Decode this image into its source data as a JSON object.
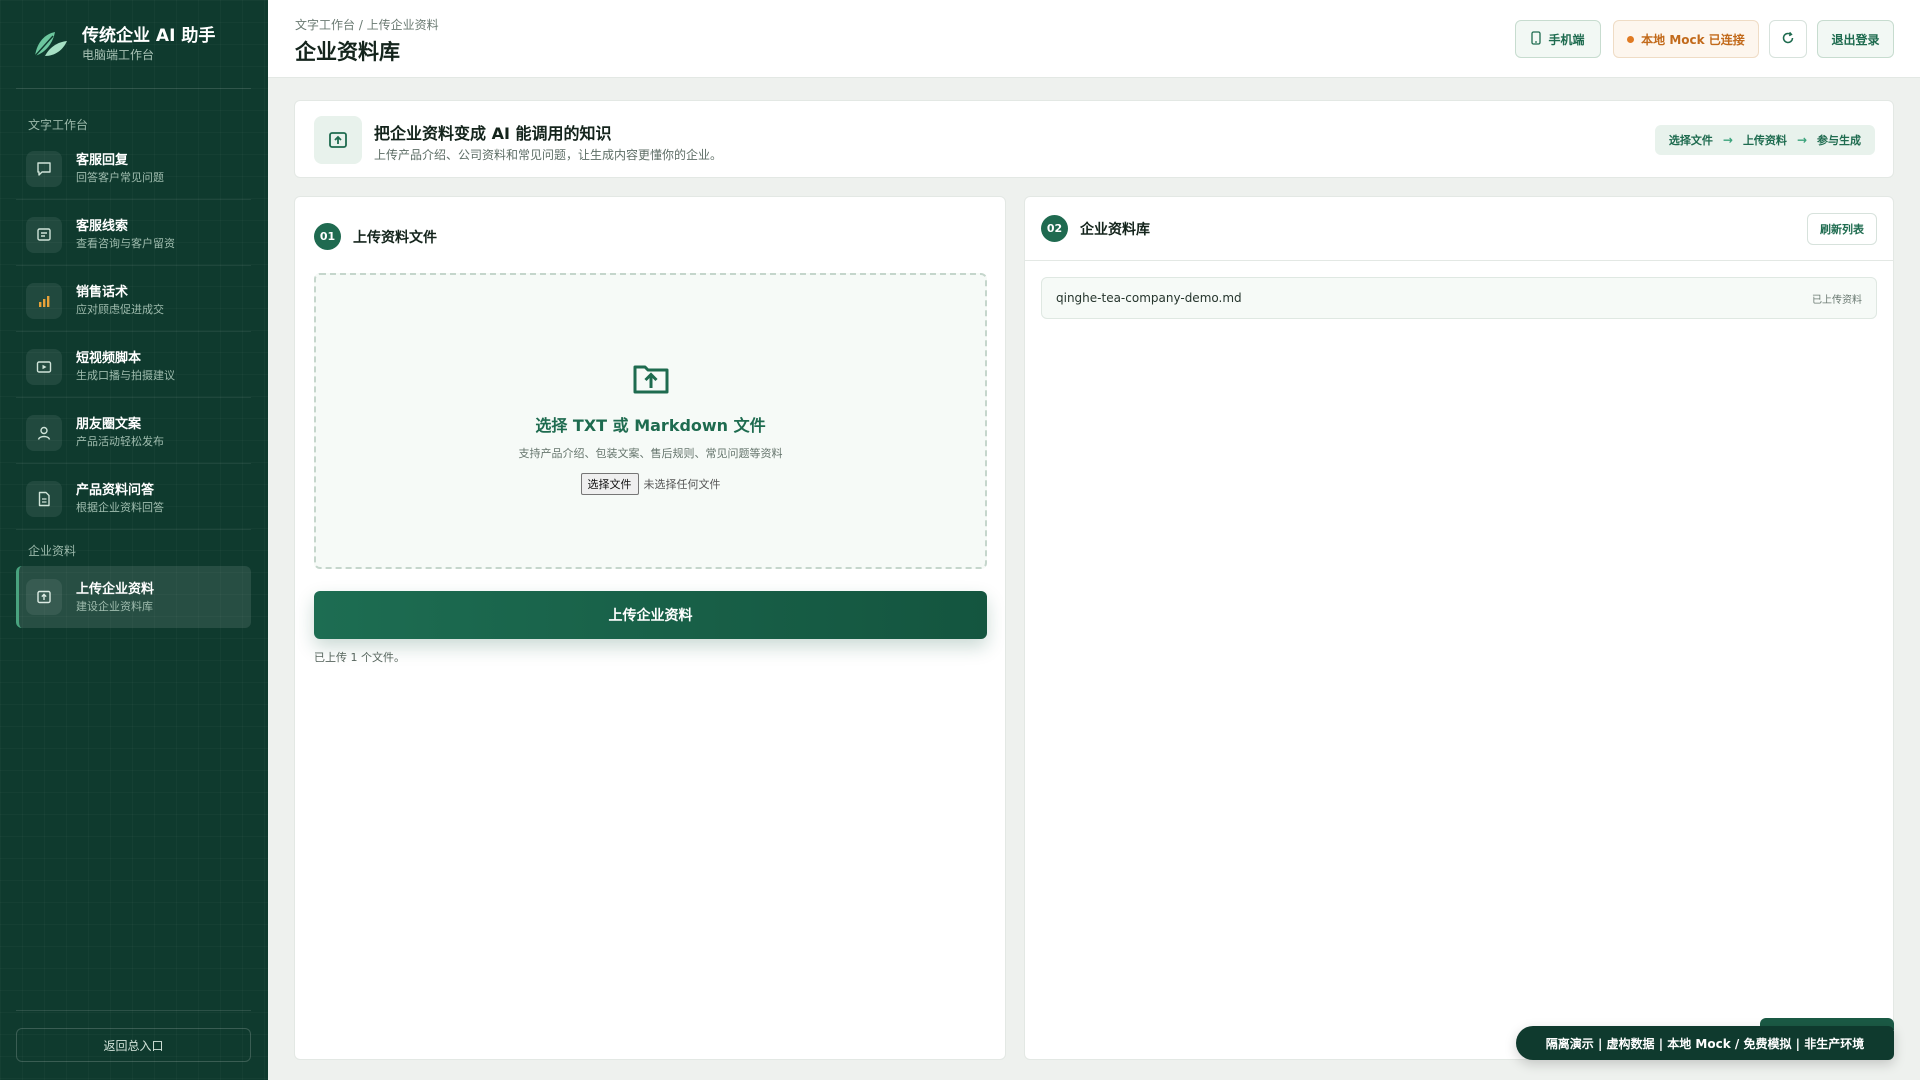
{
  "brand": {
    "title": "传统企业 AI 助手",
    "subtitle": "电脑端工作台"
  },
  "sidebar": {
    "section_text": "文字工作台",
    "section_company": "企业资料",
    "items": [
      {
        "label": "客服回复",
        "desc": "回答客户常见问题",
        "icon": "chat-bubble-icon"
      },
      {
        "label": "客服线索",
        "desc": "查看咨询与客户留资",
        "icon": "message-lines-icon"
      },
      {
        "label": "销售话术",
        "desc": "应对顾虑促进成交",
        "icon": "bar-chart-icon"
      },
      {
        "label": "短视频脚本",
        "desc": "生成口播与拍摄建议",
        "icon": "video-play-icon"
      },
      {
        "label": "朋友圈文案",
        "desc": "产品活动轻松发布",
        "icon": "user-icon"
      },
      {
        "label": "产品资料问答",
        "desc": "根据企业资料回答",
        "icon": "document-icon"
      }
    ],
    "active_item": {
      "label": "上传企业资料",
      "desc": "建设企业资料库",
      "icon": "upload-box-icon"
    },
    "back_label": "返回总入口"
  },
  "header": {
    "breadcrumb": "文字工作台 / 上传企业资料",
    "title": "企业资料库",
    "mobile_label": "手机端",
    "mock_label": "本地 Mock 已连接",
    "logout_label": "退出登录"
  },
  "banner": {
    "title": "把企业资料变成 AI 能调用的知识",
    "subtitle": "上传产品介绍、公司资料和常见问题，让生成内容更懂你的企业。",
    "steps": [
      "选择文件",
      "上传资料",
      "参与生成"
    ],
    "arrow": "→"
  },
  "upload_panel": {
    "number": "01",
    "title": "上传资料文件",
    "drop_title": "选择 TXT 或 Markdown 文件",
    "drop_sub": "支持产品介绍、包装文案、售后规则、常见问题等资料",
    "file_button": "选择文件",
    "file_none": "未选择任何文件",
    "upload_button": "上传企业资料",
    "status": "已上传 1 个文件。"
  },
  "library_panel": {
    "number": "02",
    "title": "企业资料库",
    "refresh_label": "刷新列表",
    "documents": [
      {
        "name": "qinghe-tea-company-demo.md",
        "status": "已上传资料"
      }
    ]
  },
  "demo_notice": "隔离演示 | 虚构数据 | 本地 Mock / 免费模拟 | 非生产环境",
  "colors": {
    "sidebar_bg": "#0f3a2e",
    "accent": "#1e6b4f",
    "mock_accent": "#e07a22"
  }
}
